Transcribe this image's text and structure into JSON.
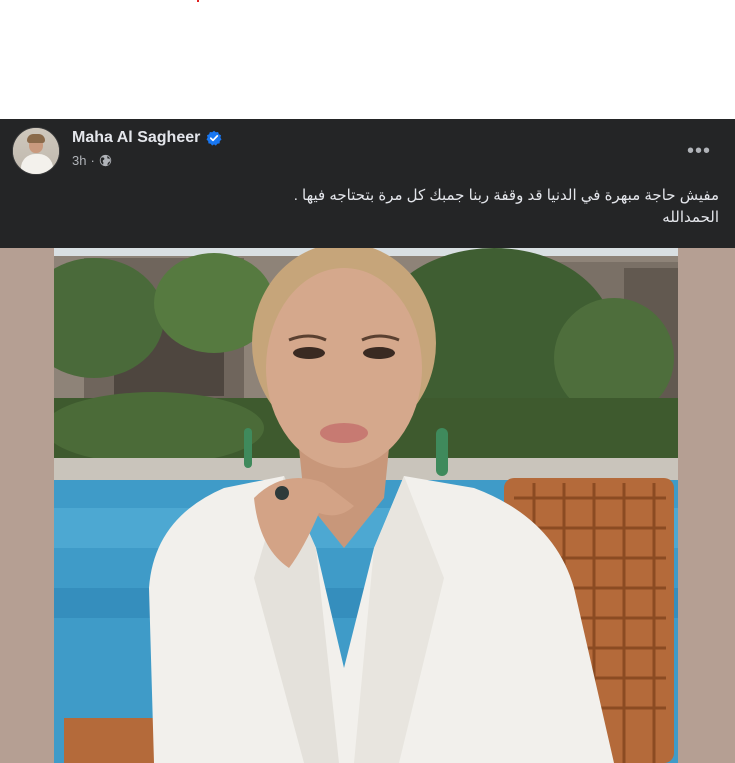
{
  "post": {
    "author": "Maha Al Sagheer",
    "time": "3h",
    "separator": "·",
    "more_label": "•••",
    "text_line1": "مفيش حاجة مبهرة في الدنيا قد وقفة ربنا جمبك كل مرة بتحتاجه فيها .",
    "text_line2": "الحمدالله"
  },
  "icons": {
    "verified": "verified-badge-icon",
    "audience": "globe-icon",
    "more": "more-options-icon"
  },
  "colors": {
    "post_background": "#242526",
    "photo_background": "#b59f93",
    "verified_blue": "#1877f2",
    "primary_text": "#e4e6eb",
    "secondary_text": "#b0b3b8"
  }
}
